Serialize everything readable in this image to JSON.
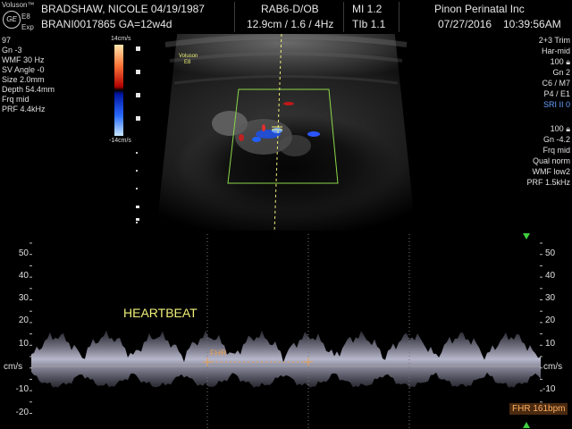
{
  "header": {
    "brand": "Voluson™",
    "model": "E8",
    "mode": "Exp",
    "logo": "GE",
    "patient_name": "BRADSHAW, NICOLE 04/19/1987",
    "patient_id": "BRANI0017865 GA=12w4d",
    "probe": "RAB6-D/OB",
    "depth_info": "12.9cm / 1.6 / 4Hz",
    "mi": "MI  1.2",
    "tib": "TIb  1.1",
    "institution": "Pinon Perinatal Inc",
    "date": "07/27/2016",
    "time": "10:39:56AM"
  },
  "left_params": [
    "97",
    "Gn  -3",
    "WMF 30 Hz",
    "SV Angle -0",
    "Size  2.0mm",
    "Depth 54.4mm",
    "Frq mid",
    "PRF  4.4kHz"
  ],
  "right_params_top": [
    "2+3 Trim",
    "Har-mid",
    "100",
    "Gn   2",
    "C6 / M7",
    "P4 / E1"
  ],
  "right_params_top_blue": "SRI II 0",
  "right_params_bottom": [
    "100",
    "Gn -4.2",
    "Frq mid",
    "Qual norm",
    "WMF low2",
    "PRF  1.5kHz"
  ],
  "colorbar": {
    "top_label": "14cm/s",
    "bottom_label": "-14cm/s"
  },
  "image_label": {
    "line1": "Voluson",
    "line2": "E8"
  },
  "doppler": {
    "scale_labels": [
      "50",
      "40",
      "30",
      "20",
      "10",
      "cm/s",
      "-10",
      "-20"
    ],
    "annotation": "HEARTBEAT",
    "fhr_marker": "FHR",
    "fhr_result": "FHR 161bpm"
  },
  "colors": {
    "fhr": "#ffb060",
    "annotation": "#f0f07a",
    "roi_box": "#8cd84a",
    "sri": "#6aa0ff"
  },
  "icons": {
    "lock": "lock-icon",
    "cursor": "cursor-line",
    "marker": "triangle-marker-icon"
  }
}
